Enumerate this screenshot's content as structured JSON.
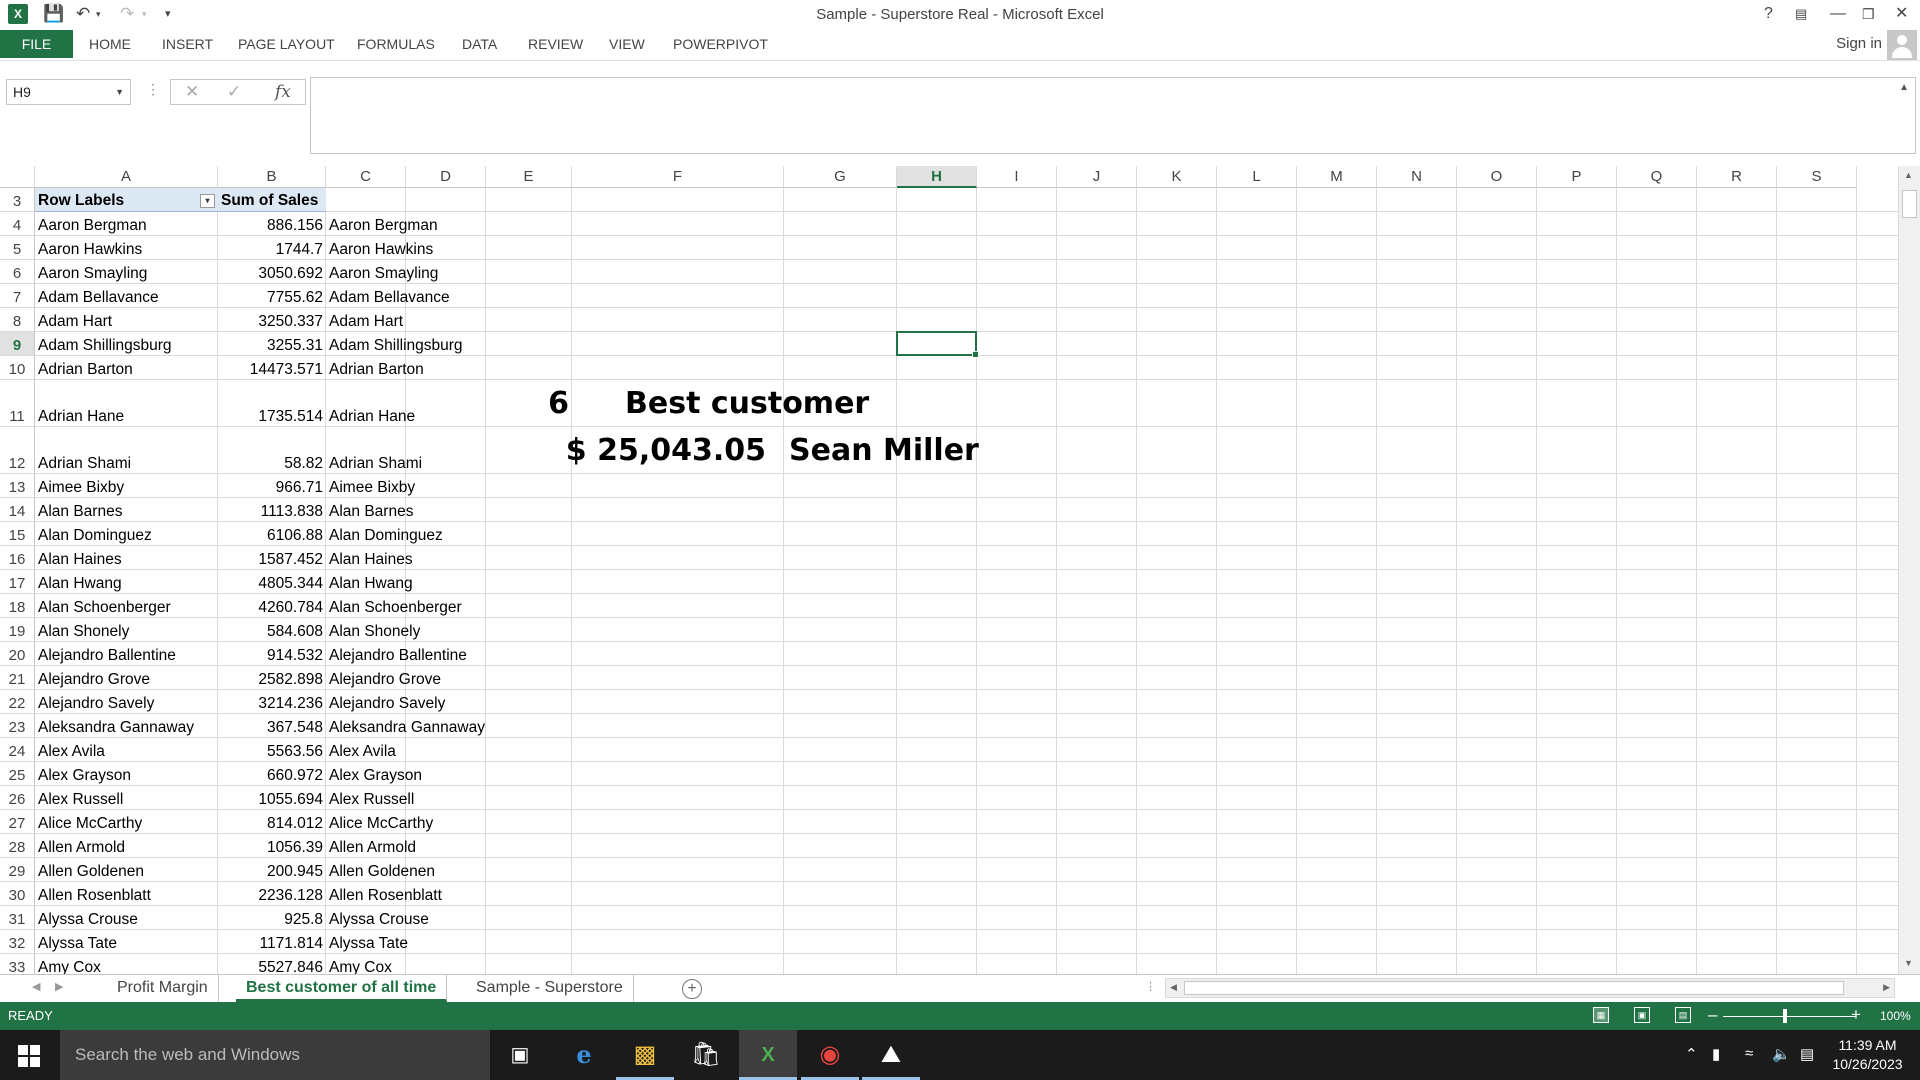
{
  "window": {
    "title": "Sample - Superstore Real - Microsoft Excel",
    "help": "?",
    "sign_in": "Sign in"
  },
  "ribbon": {
    "file": "FILE",
    "tabs": [
      "HOME",
      "INSERT",
      "PAGE LAYOUT",
      "FORMULAS",
      "DATA",
      "REVIEW",
      "VIEW",
      "POWERPIVOT"
    ]
  },
  "formula_bar": {
    "name_box": "H9",
    "formula": ""
  },
  "grid": {
    "columns": [
      "A",
      "B",
      "C",
      "D",
      "E",
      "F",
      "G",
      "H",
      "I",
      "J",
      "K",
      "L",
      "M",
      "N",
      "O",
      "P",
      "Q",
      "R",
      "S"
    ],
    "selected_column": "H",
    "selected_row": "9",
    "header": {
      "row_labels": "Row Labels",
      "sum_of_sales": "Sum of Sales"
    },
    "rows": [
      {
        "n": "4",
        "name": "Aaron Bergman",
        "sales": "886.156",
        "c": "Aaron Bergman"
      },
      {
        "n": "5",
        "name": "Aaron Hawkins",
        "sales": "1744.7",
        "c": "Aaron Hawkins"
      },
      {
        "n": "6",
        "name": "Aaron Smayling",
        "sales": "3050.692",
        "c": "Aaron Smayling"
      },
      {
        "n": "7",
        "name": "Adam Bellavance",
        "sales": "7755.62",
        "c": "Adam Bellavance"
      },
      {
        "n": "8",
        "name": "Adam Hart",
        "sales": "3250.337",
        "c": "Adam Hart"
      },
      {
        "n": "9",
        "name": "Adam Shillingsburg",
        "sales": "3255.31",
        "c": "Adam Shillingsburg"
      },
      {
        "n": "10",
        "name": "Adrian Barton",
        "sales": "14473.571",
        "c": "Adrian Barton"
      },
      {
        "n": "11",
        "name": "Adrian Hane",
        "sales": "1735.514",
        "c": "Adrian Hane"
      },
      {
        "n": "12",
        "name": "Adrian Shami",
        "sales": "58.82",
        "c": "Adrian Shami"
      },
      {
        "n": "13",
        "name": "Aimee Bixby",
        "sales": "966.71",
        "c": "Aimee Bixby"
      },
      {
        "n": "14",
        "name": "Alan Barnes",
        "sales": "1113.838",
        "c": "Alan Barnes"
      },
      {
        "n": "15",
        "name": "Alan Dominguez",
        "sales": "6106.88",
        "c": "Alan Dominguez"
      },
      {
        "n": "16",
        "name": "Alan Haines",
        "sales": "1587.452",
        "c": "Alan Haines"
      },
      {
        "n": "17",
        "name": "Alan Hwang",
        "sales": "4805.344",
        "c": "Alan Hwang"
      },
      {
        "n": "18",
        "name": "Alan Schoenberger",
        "sales": "4260.784",
        "c": "Alan Schoenberger"
      },
      {
        "n": "19",
        "name": "Alan Shonely",
        "sales": "584.608",
        "c": "Alan Shonely"
      },
      {
        "n": "20",
        "name": "Alejandro Ballentine",
        "sales": "914.532",
        "c": "Alejandro Ballentine"
      },
      {
        "n": "21",
        "name": "Alejandro Grove",
        "sales": "2582.898",
        "c": "Alejandro Grove"
      },
      {
        "n": "22",
        "name": "Alejandro Savely",
        "sales": "3214.236",
        "c": "Alejandro Savely"
      },
      {
        "n": "23",
        "name": "Aleksandra Gannaway",
        "sales": "367.548",
        "c": "Aleksandra Gannaway"
      },
      {
        "n": "24",
        "name": "Alex Avila",
        "sales": "5563.56",
        "c": "Alex Avila"
      },
      {
        "n": "25",
        "name": "Alex Grayson",
        "sales": "660.972",
        "c": "Alex Grayson"
      },
      {
        "n": "26",
        "name": "Alex Russell",
        "sales": "1055.694",
        "c": "Alex Russell"
      },
      {
        "n": "27",
        "name": "Alice McCarthy",
        "sales": "814.012",
        "c": "Alice McCarthy"
      },
      {
        "n": "28",
        "name": "Allen Armold",
        "sales": "1056.39",
        "c": "Allen Armold"
      },
      {
        "n": "29",
        "name": "Allen Goldenen",
        "sales": "200.945",
        "c": "Allen Goldenen"
      },
      {
        "n": "30",
        "name": "Allen Rosenblatt",
        "sales": "2236.128",
        "c": "Allen Rosenblatt"
      },
      {
        "n": "31",
        "name": "Alyssa Crouse",
        "sales": "925.8",
        "c": "Alyssa Crouse"
      },
      {
        "n": "32",
        "name": "Alyssa Tate",
        "sales": "1171.814",
        "c": "Alyssa Tate"
      },
      {
        "n": "33",
        "name": "Amy Cox",
        "sales": "5527.846",
        "c": "Amy Cox"
      }
    ],
    "highlight": {
      "e11": "6",
      "f11": "Best customer",
      "f12": "$ 25,043.05",
      "g12": "Sean Miller"
    }
  },
  "sheets": {
    "tabs": [
      "Profit Margin",
      "Best customer of all time",
      "Sample - Superstore"
    ],
    "active": "Best customer of all time"
  },
  "status": {
    "mode": "READY",
    "zoom": "100%"
  },
  "taskbar": {
    "search_placeholder": "Search the web and Windows",
    "time": "11:39 AM",
    "date": "10/26/2023"
  },
  "colors": {
    "excel_green": "#217346",
    "pivot_header": "#dde8f5",
    "taskbar": "#1b1b1b"
  }
}
